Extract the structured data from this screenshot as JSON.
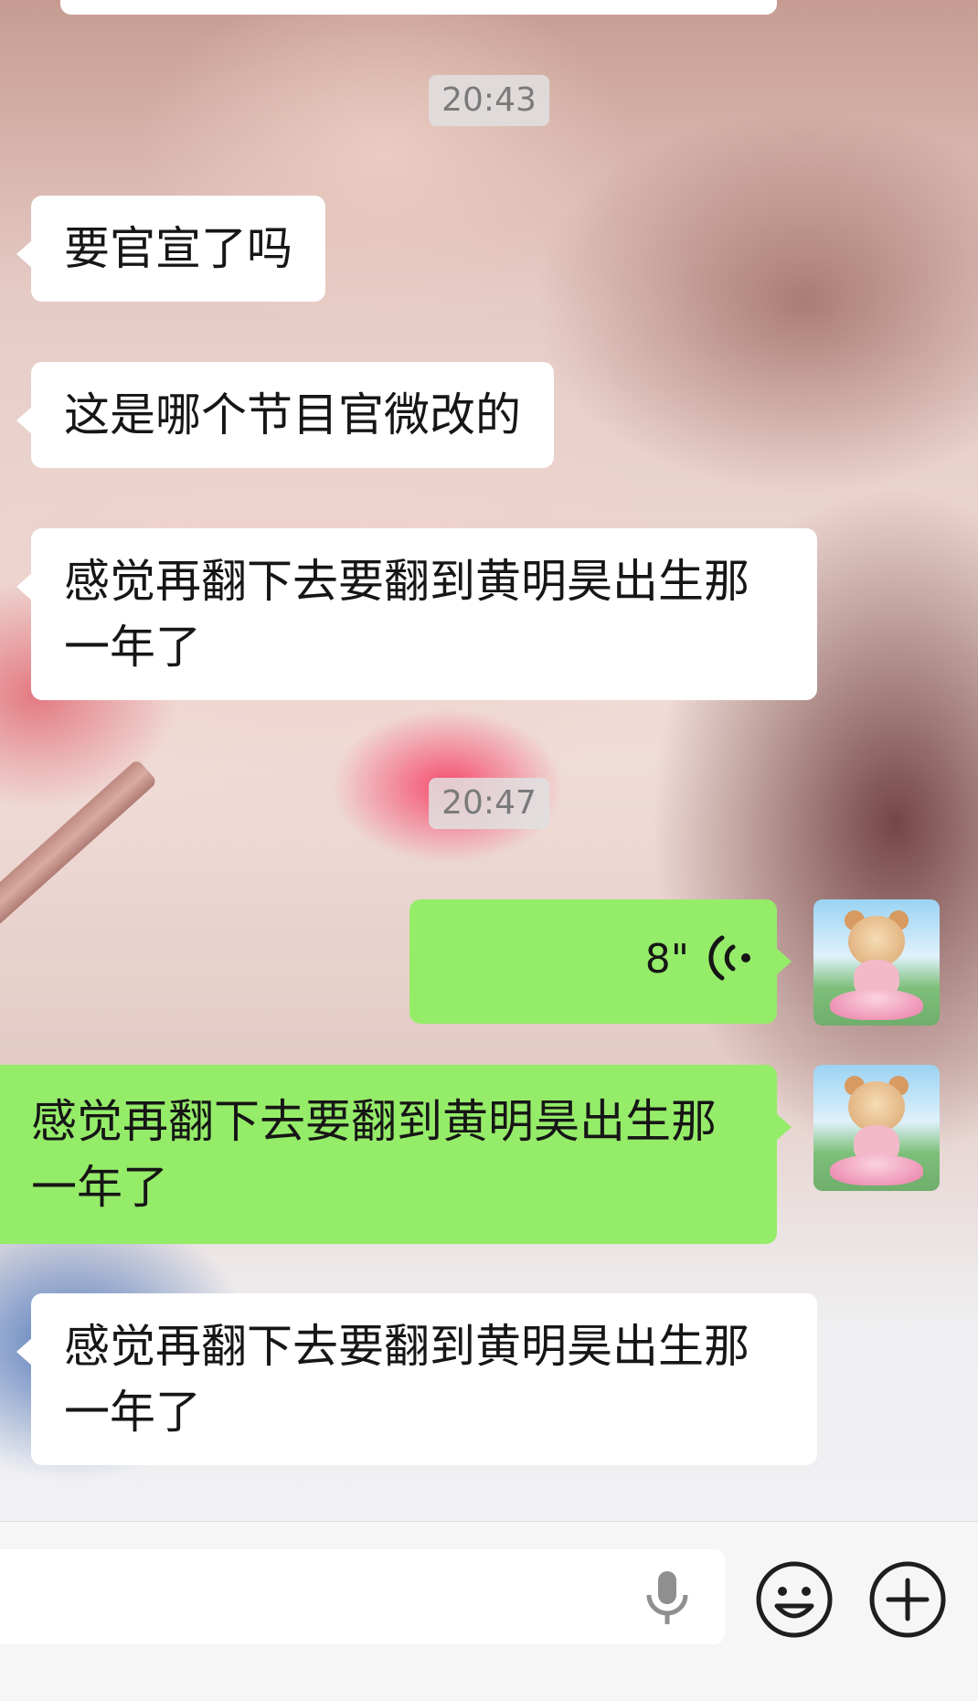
{
  "chat": {
    "messages": [
      {
        "type": "timestamp",
        "text": "20:43"
      },
      {
        "type": "incoming",
        "text": "要官宣了吗"
      },
      {
        "type": "incoming",
        "text": "这是哪个节目官微改的"
      },
      {
        "type": "incoming",
        "text": "感觉再翻下去要翻到黄明昊出生那一年了"
      },
      {
        "type": "timestamp",
        "text": "20:47"
      },
      {
        "type": "outgoing_voice",
        "duration": "8\""
      },
      {
        "type": "outgoing",
        "text": "感觉再翻下去要翻到黄明昊出生那一年了"
      },
      {
        "type": "incoming",
        "text": "感觉再翻下去要翻到黄明昊出生那一年了"
      }
    ]
  },
  "input_bar": {
    "placeholder": "",
    "icons": {
      "voice": "microphone-icon",
      "emoji": "smiley-face-icon",
      "more": "plus-circle-icon"
    }
  },
  "colors": {
    "outgoing_bubble": "#95ec69",
    "incoming_bubble": "#ffffff",
    "timestamp_bg": "#e1e1e1"
  }
}
